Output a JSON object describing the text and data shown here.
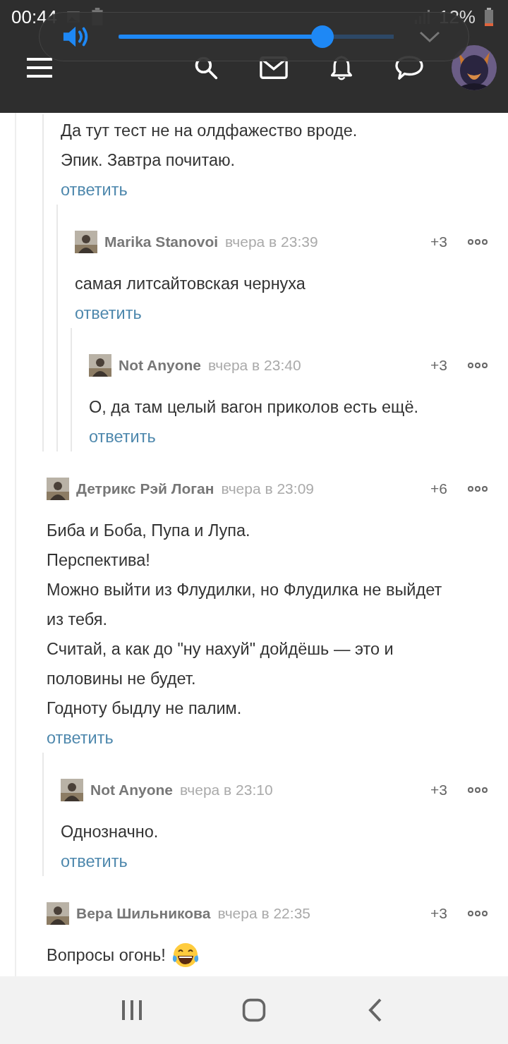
{
  "status_bar": {
    "time": "00:44",
    "battery": "12%"
  },
  "volume_panel": {
    "level": 0.74
  },
  "thread": [
    {
      "children": [
        {
          "lines": [
            "Да тут тест не на олдфажество вроде.",
            "Эпик. Завтра почитаю."
          ],
          "reply": "ответить",
          "children": [
            {
              "author": "Marika Stanovoi",
              "time": "вчера в 23:39",
              "score": "+3",
              "lines": [
                "самая литсайтовская чернуха"
              ],
              "reply": "ответить",
              "children": [
                {
                  "author": "Not Anyone",
                  "time": "вчера в 23:40",
                  "score": "+3",
                  "lines": [
                    "О, да там целый вагон приколов есть ещё."
                  ],
                  "reply": "ответить"
                }
              ]
            }
          ]
        }
      ]
    },
    {
      "author": "Детрикс Рэй Логан",
      "time": "вчера в 23:09",
      "score": "+6",
      "lines": [
        "Биба и Боба, Пупа и Лупа.",
        "Перспектива!",
        "Можно выйти из Флудилки, но Флудилка не выйдет из тебя.",
        "Считай, а как до \"ну нахуй\" дойдёшь — это и половины не будет.",
        "Годноту быдлу не палим."
      ],
      "reply": "ответить",
      "children": [
        {
          "author": "Not Anyone",
          "time": "вчера в 23:10",
          "score": "+3",
          "lines": [
            "Однозначно."
          ],
          "reply": "ответить"
        }
      ]
    },
    {
      "author": "Вера Шильникова",
      "time": "вчера в 22:35",
      "score": "+3",
      "lines": [
        "Вопросы огонь!"
      ],
      "emoji": true
    }
  ]
}
